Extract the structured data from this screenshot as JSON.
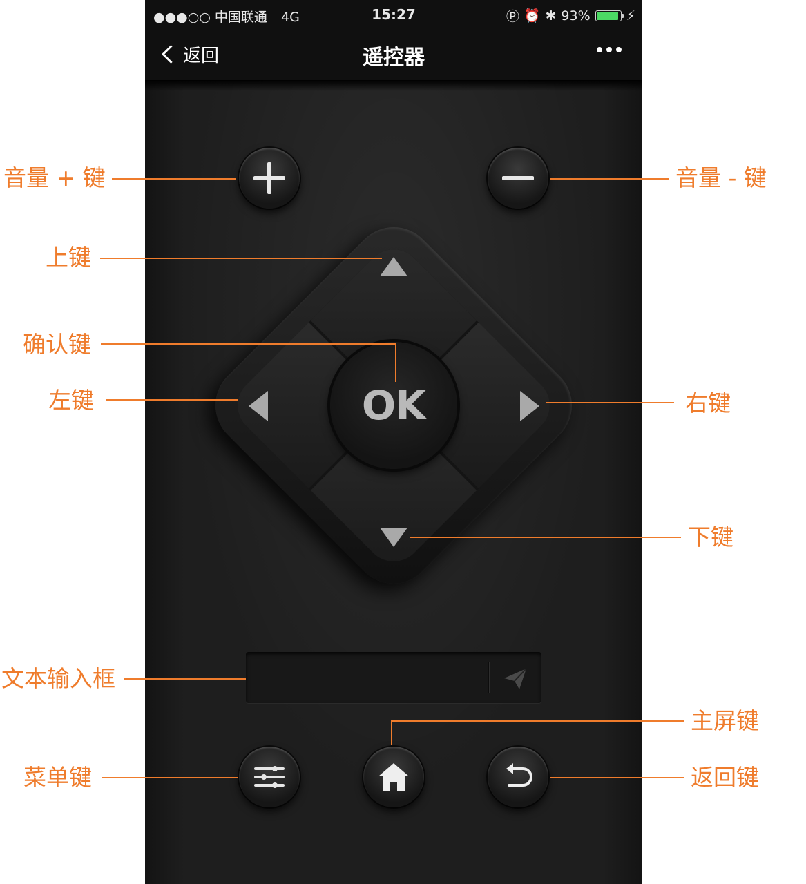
{
  "status_bar": {
    "carrier": "●●●○○ 中国联通",
    "network": "4G",
    "time": "15:27",
    "battery": "93%",
    "battery_level": 0.93
  },
  "navbar": {
    "back_label": "返回",
    "title": "遥控器"
  },
  "annotations": {
    "vol_up": "音量 + 键",
    "vol_down": "音量 - 键",
    "up": "上键",
    "ok": "确认键",
    "left": "左键",
    "right": "右键",
    "down": "下键",
    "text_input": "文本输入框",
    "home": "主屏键",
    "menu": "菜单键",
    "back": "返回键"
  },
  "dpad": {
    "ok_label": "OK"
  },
  "colors": {
    "annotation": "#ef7c2c",
    "battery": "#4cd964"
  }
}
